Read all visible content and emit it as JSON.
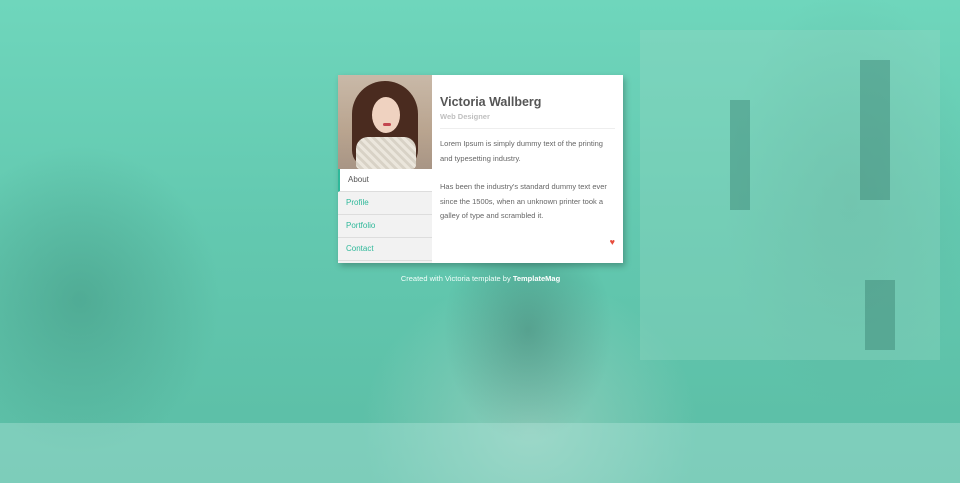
{
  "profile": {
    "name": "Victoria Wallberg",
    "role": "Web Designer",
    "bio_1": "Lorem Ipsum is simply dummy text of the printing and typesetting industry.",
    "bio_2": "Has been the industry's standard dummy text ever since the 1500s, when an unknown printer took a galley of type and scrambled it."
  },
  "nav": {
    "items": [
      {
        "label": "About"
      },
      {
        "label": "Profile"
      },
      {
        "label": "Portfolio"
      },
      {
        "label": "Contact"
      }
    ]
  },
  "footer": {
    "prefix": "Created with Victoria template by ",
    "link": "TemplateMag"
  },
  "colors": {
    "accent": "#2fb89a",
    "overlay": "#6fd6bc",
    "heart": "#e74c3c"
  },
  "icons": {
    "heart": "heart-icon"
  }
}
